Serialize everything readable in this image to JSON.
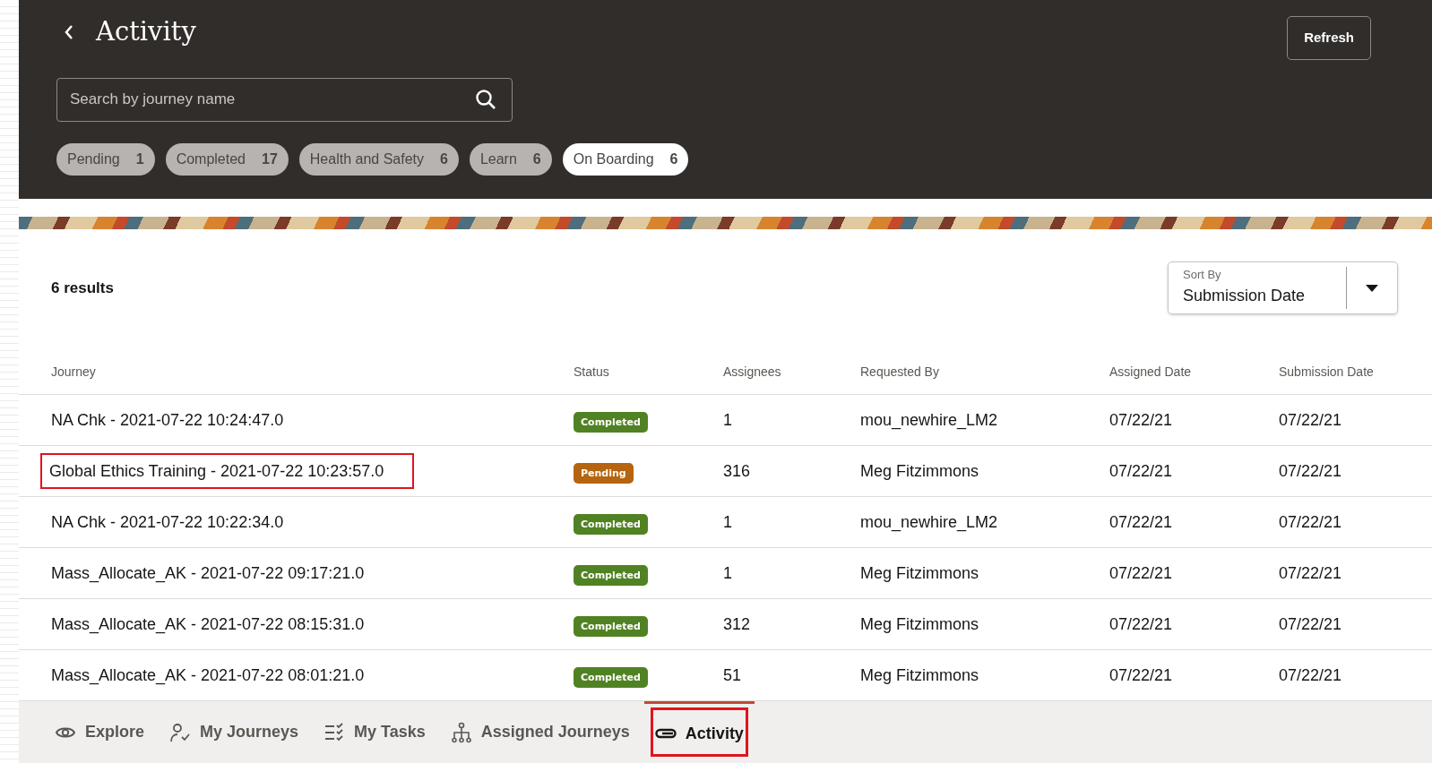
{
  "header": {
    "title": "Activity",
    "refresh_button": "Refresh",
    "search": {
      "placeholder": "Search by journey name"
    },
    "filters": [
      {
        "label": "Pending",
        "count": "1",
        "selected": false
      },
      {
        "label": "Completed",
        "count": "17",
        "selected": false
      },
      {
        "label": "Health and Safety",
        "count": "6",
        "selected": false
      },
      {
        "label": "Learn",
        "count": "6",
        "selected": false
      },
      {
        "label": "On Boarding",
        "count": "6",
        "selected": true
      }
    ]
  },
  "results": {
    "count": "6 results",
    "sort": {
      "label": "Sort By",
      "value": "Submission Date"
    }
  },
  "table": {
    "columns": [
      "Journey",
      "Status",
      "Assignees",
      "Requested By",
      "Assigned Date",
      "Submission Date"
    ],
    "rows": [
      {
        "journey": "NA Chk - 2021-07-22 10:24:47.0",
        "status": {
          "label": "Completed",
          "kind": "completed"
        },
        "assignees": "1",
        "requested_by": "mou_newhire_LM2",
        "assigned_date": "07/22/21",
        "submission_date": "07/22/21",
        "highlighted": false
      },
      {
        "journey": "Global Ethics Training - 2021-07-22 10:23:57.0",
        "status": {
          "label": "Pending",
          "kind": "pending"
        },
        "assignees": "316",
        "requested_by": "Meg Fitzimmons",
        "assigned_date": "07/22/21",
        "submission_date": "07/22/21",
        "highlighted": true
      },
      {
        "journey": "NA Chk - 2021-07-22 10:22:34.0",
        "status": {
          "label": "Completed",
          "kind": "completed"
        },
        "assignees": "1",
        "requested_by": "mou_newhire_LM2",
        "assigned_date": "07/22/21",
        "submission_date": "07/22/21",
        "highlighted": false
      },
      {
        "journey": "Mass_Allocate_AK - 2021-07-22 09:17:21.0",
        "status": {
          "label": "Completed",
          "kind": "completed"
        },
        "assignees": "1",
        "requested_by": "Meg Fitzimmons",
        "assigned_date": "07/22/21",
        "submission_date": "07/22/21",
        "highlighted": false
      },
      {
        "journey": "Mass_Allocate_AK - 2021-07-22 08:15:31.0",
        "status": {
          "label": "Completed",
          "kind": "completed"
        },
        "assignees": "312",
        "requested_by": "Meg Fitzimmons",
        "assigned_date": "07/22/21",
        "submission_date": "07/22/21",
        "highlighted": false
      },
      {
        "journey": "Mass_Allocate_AK - 2021-07-22 08:01:21.0",
        "status": {
          "label": "Completed",
          "kind": "completed"
        },
        "assignees": "51",
        "requested_by": "Meg Fitzimmons",
        "assigned_date": "07/22/21",
        "submission_date": "07/22/21",
        "highlighted": false
      }
    ]
  },
  "bottom_nav": [
    {
      "label": "Explore",
      "selected": false,
      "highlighted": false
    },
    {
      "label": "My Journeys",
      "selected": false,
      "highlighted": false
    },
    {
      "label": "My Tasks",
      "selected": false,
      "highlighted": false
    },
    {
      "label": "Assigned Journeys",
      "selected": false,
      "highlighted": false
    },
    {
      "label": "Activity",
      "selected": true,
      "highlighted": true
    }
  ]
}
